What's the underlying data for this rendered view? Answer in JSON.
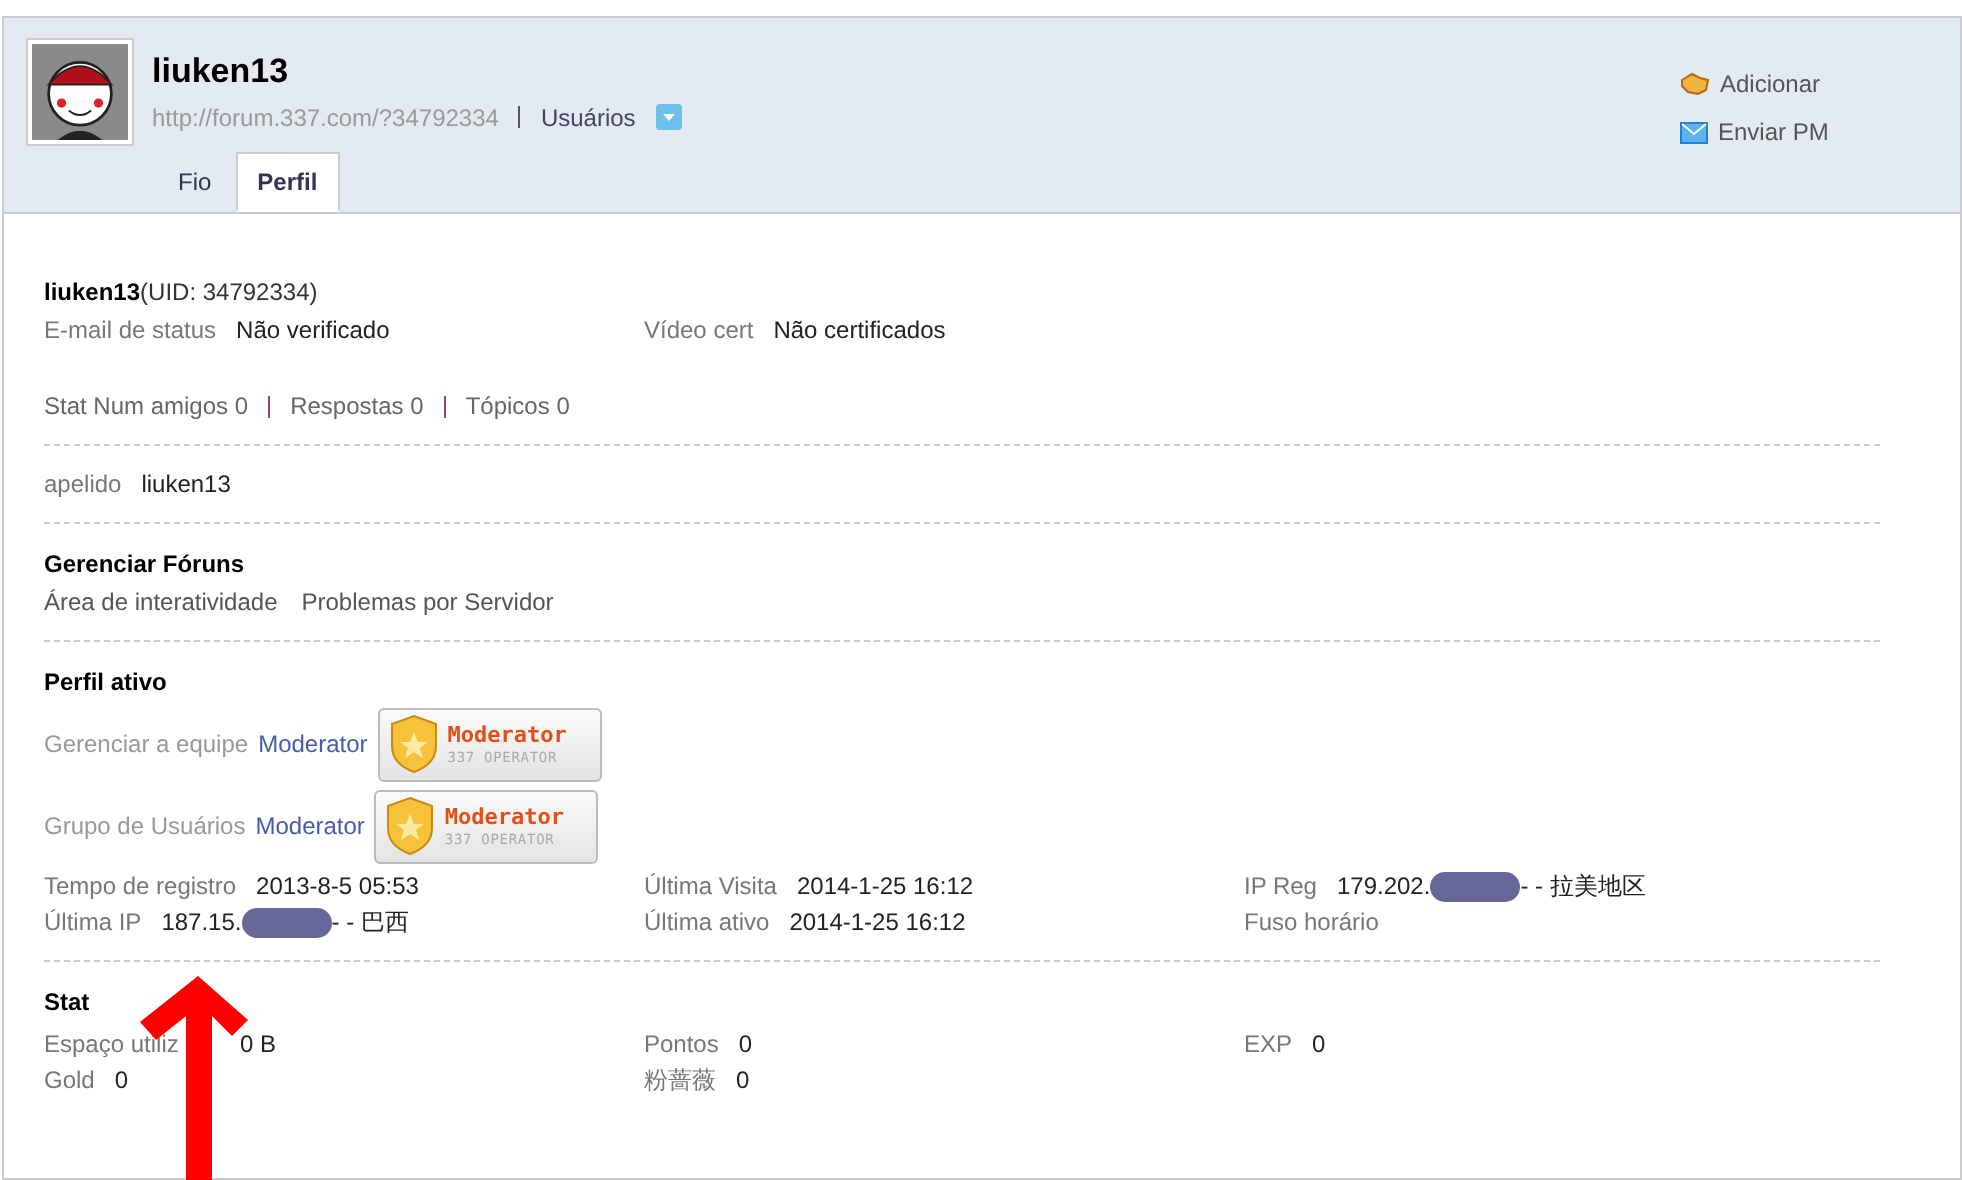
{
  "header": {
    "username": "liuken13",
    "url": "http://forum.337.com/?34792334",
    "group_link": "Usuários",
    "actions": [
      {
        "kind": "friend",
        "label": "Adicionar"
      },
      {
        "kind": "mail",
        "label": "Enviar PM"
      }
    ],
    "tabs": [
      {
        "label": "Fio",
        "selected": false
      },
      {
        "label": "Perfil",
        "selected": true
      }
    ]
  },
  "profile": {
    "name": "liuken13",
    "uid": "(UID: 34792334)",
    "cert": [
      {
        "label": "E-mail de status",
        "value": "Não verificado"
      },
      {
        "label": "Vídeo cert",
        "value": "Não certificados"
      }
    ],
    "stats": [
      {
        "label": "Stat Num amigos",
        "value": "0"
      },
      {
        "label": "Respostas",
        "value": "0"
      },
      {
        "label": "Tópicos",
        "value": "0"
      }
    ],
    "nickname": {
      "label": "apelido",
      "value": "liuken13"
    }
  },
  "forums": {
    "title": "Gerenciar Fóruns",
    "items": [
      "Área de interatividade",
      "Problemas por Servidor"
    ]
  },
  "active": {
    "title": "Perfil ativo",
    "roles": [
      {
        "label": "Gerenciar a equipe",
        "value": "Moderator",
        "badge_title": "Moderator",
        "badge_sub": "337 OPERATOR"
      },
      {
        "label": "Grupo de Usuários",
        "value": "Moderator",
        "badge_title": "Moderator",
        "badge_sub": "337 OPERATOR"
      }
    ],
    "info": [
      [
        {
          "label": "Tempo de registro",
          "value": "2013-8-5 05:53"
        },
        {
          "label": "Última IP",
          "value": "187.15.",
          "redacted": true,
          "suffix": "- - 巴西"
        }
      ],
      [
        {
          "label": "Última Visita",
          "value": "2014-1-25 16:12"
        },
        {
          "label": "Última ativo",
          "value": "2014-1-25 16:12"
        }
      ],
      [
        {
          "label": "IP Reg",
          "value": "179.202.",
          "redacted": true,
          "suffix": "- - 拉美地区"
        },
        {
          "label": "Fuso horário"
        }
      ]
    ]
  },
  "stat": {
    "title": "Stat",
    "columns": [
      [
        {
          "label": "Espaço utiliz",
          "value": "0 B"
        },
        {
          "label": "Gold",
          "value": "0"
        }
      ],
      [
        {
          "label": "Pontos",
          "value": "0"
        },
        {
          "label": "粉蔷薇",
          "value": "0"
        }
      ],
      [
        {
          "label": "EXP",
          "value": "0"
        }
      ]
    ]
  }
}
